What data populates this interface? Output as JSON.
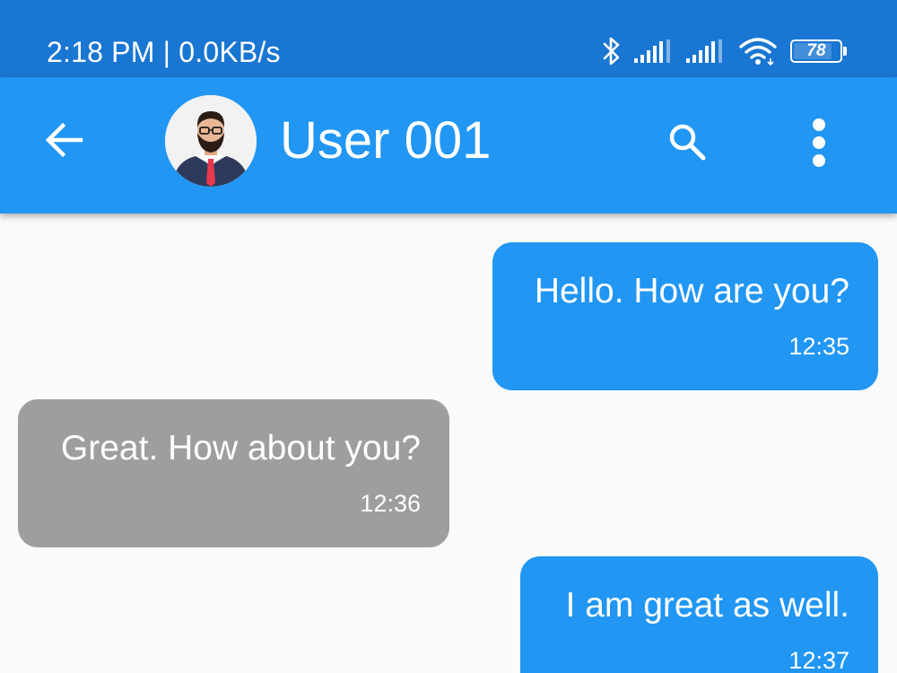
{
  "status_bar": {
    "time_speed": "2:18 PM | 0.0KB/s",
    "battery_level": "78",
    "icons": [
      "bluetooth-icon",
      "signal-icon",
      "signal-icon",
      "wifi-icon",
      "battery-icon"
    ]
  },
  "app_bar": {
    "title": "User 001",
    "icons": [
      "back-arrow-icon",
      "avatar",
      "search-icon",
      "more-vert-icon"
    ]
  },
  "messages": [
    {
      "side": "sent",
      "text": "Hello. How are you?",
      "time": "12:35"
    },
    {
      "side": "received",
      "text": "Great. How about you?",
      "time": "12:36"
    },
    {
      "side": "sent",
      "text": "I am great as well.",
      "time": "12:37"
    }
  ],
  "colors": {
    "status_bar": "#1976d2",
    "app_bar": "#2196f3",
    "sent_bubble": "#2196f3",
    "received_bubble": "#9e9e9e",
    "background": "#fafafa"
  }
}
